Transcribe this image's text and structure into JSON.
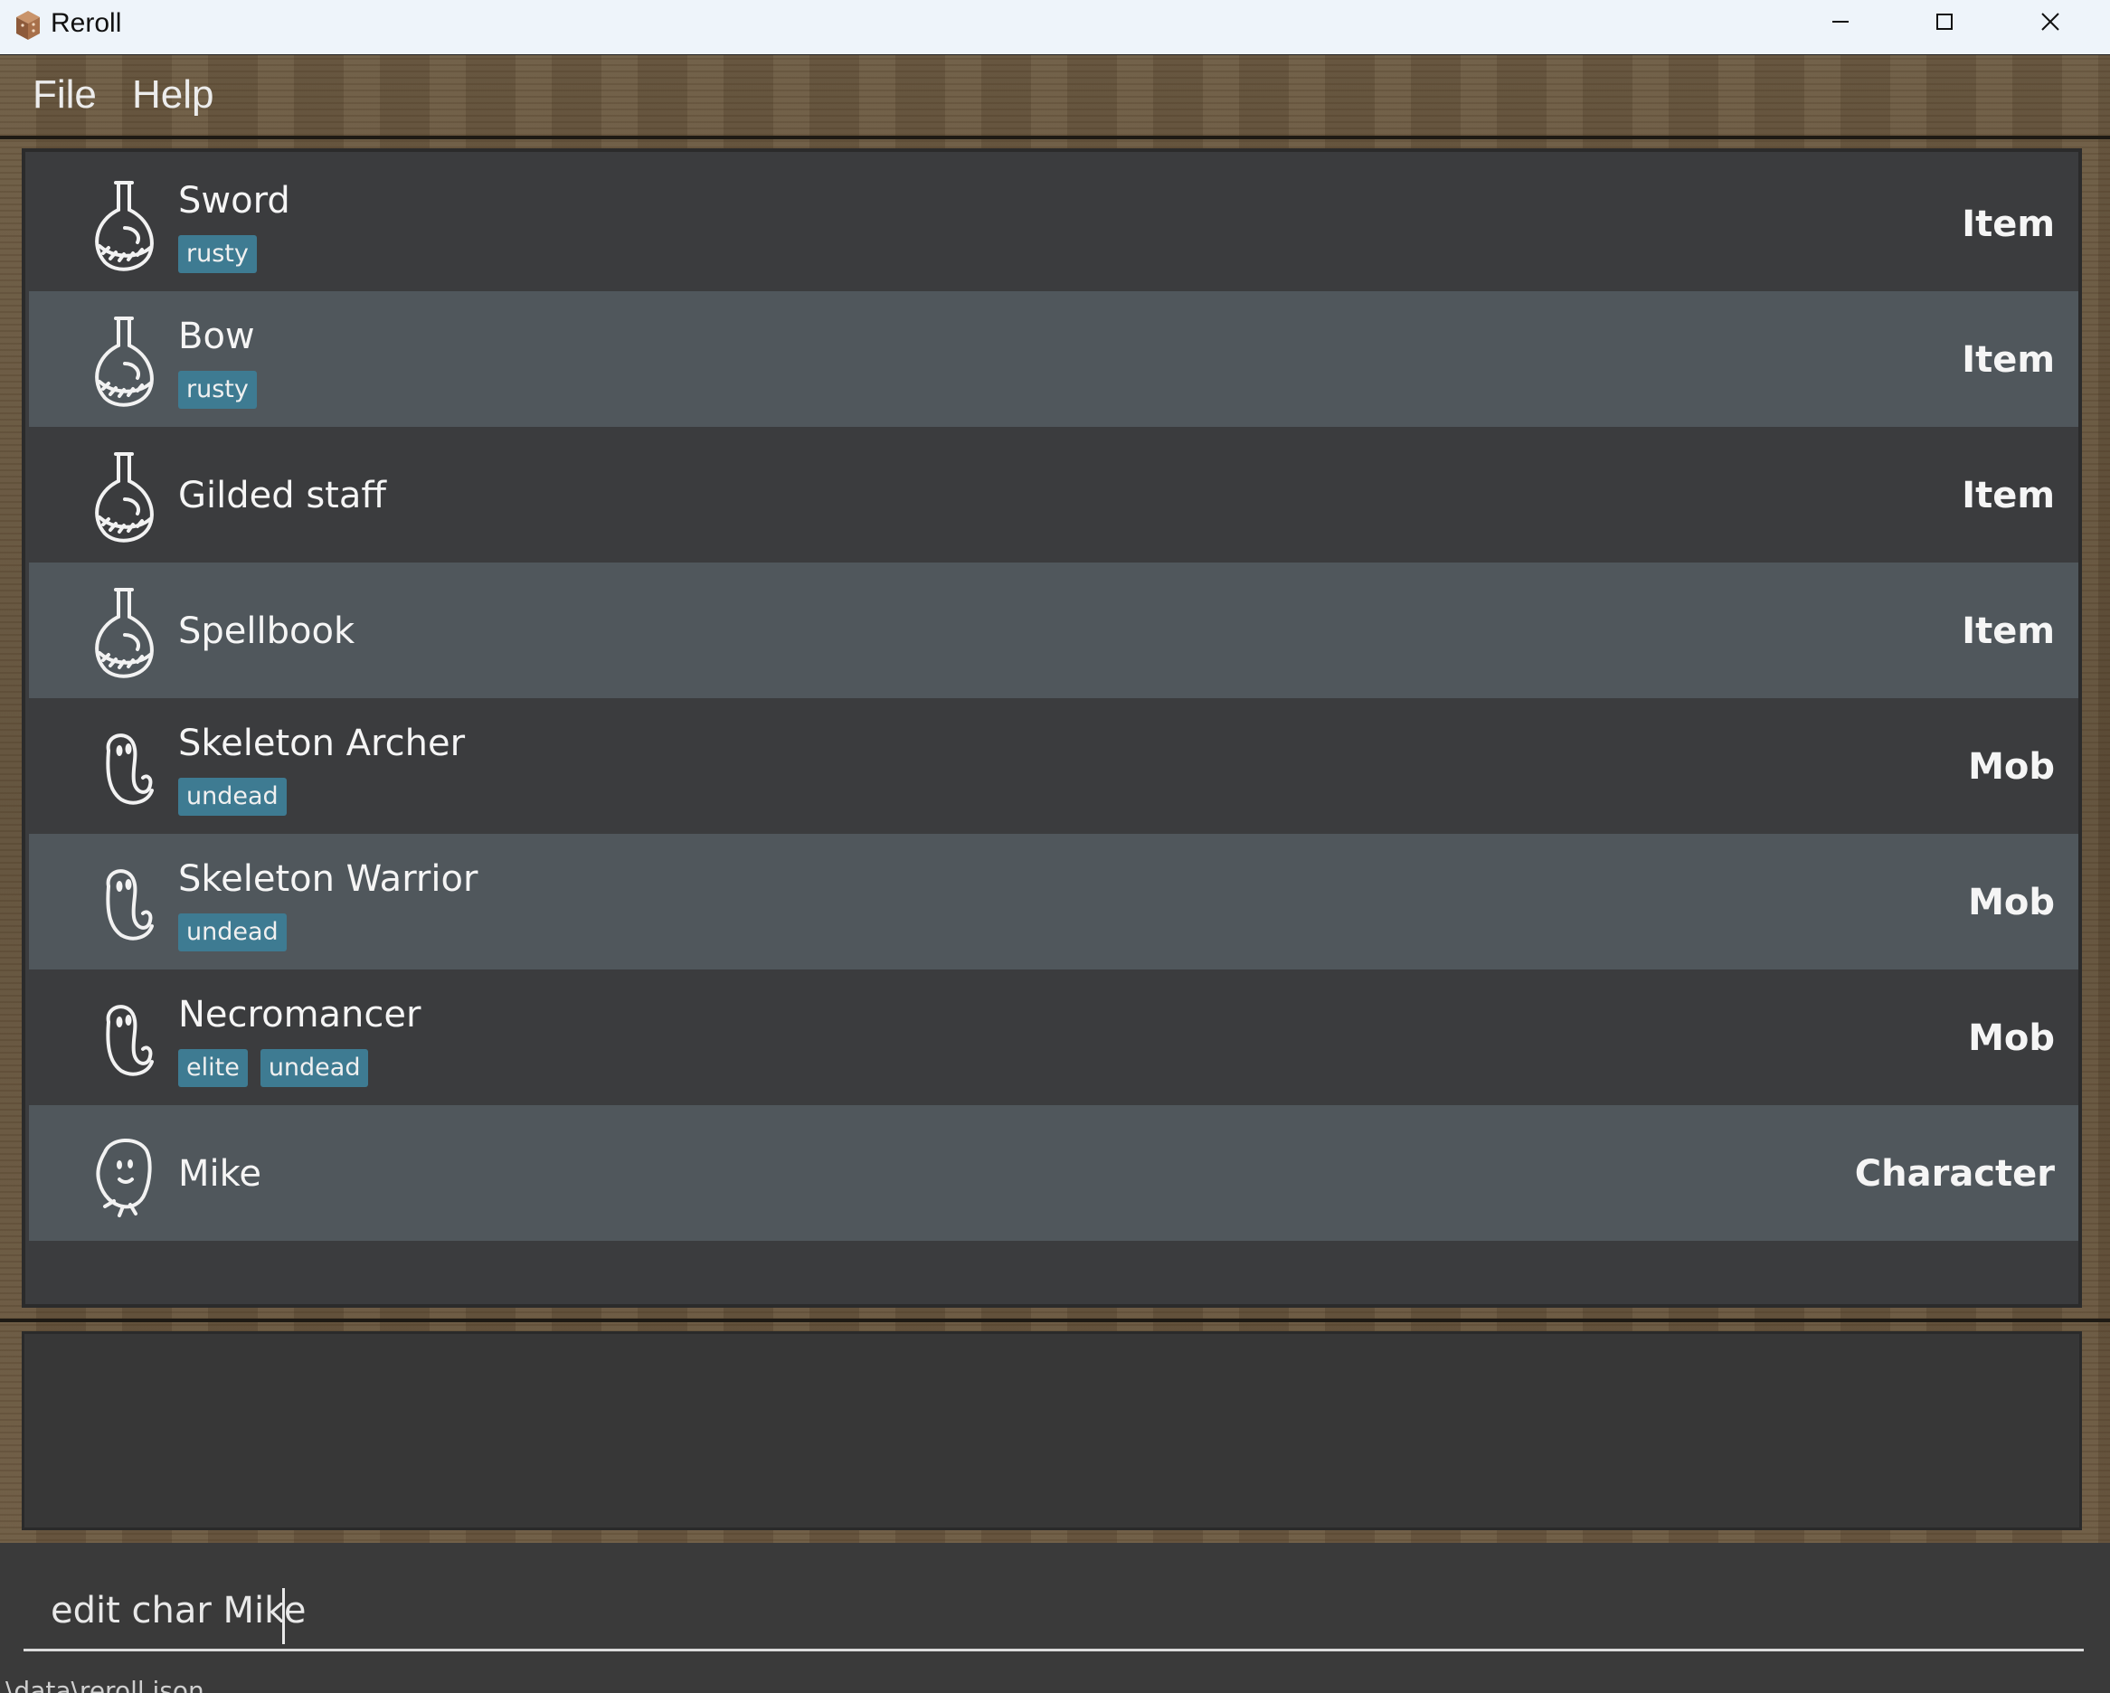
{
  "window": {
    "title": "Reroll",
    "icon": "app-logo-icon"
  },
  "menu": {
    "file": "File",
    "help": "Help"
  },
  "entries": [
    {
      "name": "Sword",
      "tags": [
        "rusty"
      ],
      "type": "Item",
      "icon": "potion-icon"
    },
    {
      "name": "Bow",
      "tags": [
        "rusty"
      ],
      "type": "Item",
      "icon": "potion-icon"
    },
    {
      "name": "Gilded staff",
      "tags": [],
      "type": "Item",
      "icon": "potion-icon"
    },
    {
      "name": "Spellbook",
      "tags": [],
      "type": "Item",
      "icon": "potion-icon"
    },
    {
      "name": "Skeleton Archer",
      "tags": [
        "undead"
      ],
      "type": "Mob",
      "icon": "ghost-icon"
    },
    {
      "name": "Skeleton Warrior",
      "tags": [
        "undead"
      ],
      "type": "Mob",
      "icon": "ghost-icon"
    },
    {
      "name": "Necromancer",
      "tags": [
        "elite",
        "undead"
      ],
      "type": "Mob",
      "icon": "ghost-icon"
    },
    {
      "name": "Mike",
      "tags": [],
      "type": "Character",
      "icon": "character-icon"
    }
  ],
  "command": {
    "value": "edit char Mike"
  },
  "status": {
    "path": "\\data\\reroll.json"
  },
  "colors": {
    "row_dark": "#3b3c3e",
    "row_light": "#50575c",
    "tag": "#3e7b92",
    "wood": "#5d4d38"
  }
}
